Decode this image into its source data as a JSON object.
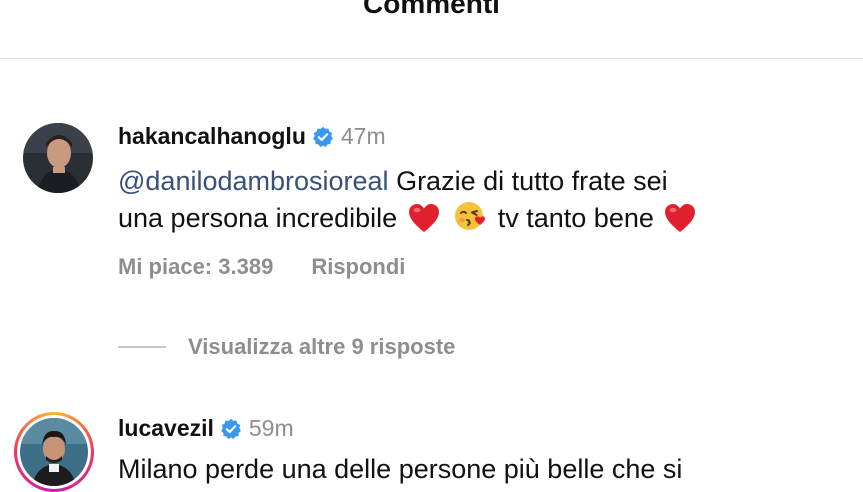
{
  "header": {
    "title": "Commenti"
  },
  "comments": [
    {
      "username": "hakancalhanoglu",
      "verified": true,
      "time": "47m",
      "mention": "@danilodambrosioreal",
      "text_part1": " Grazie di tutto frate sei",
      "text_part2": "una persona incredibile",
      "text_part3": " tv tanto bene",
      "emojis": [
        "red-heart-emoji",
        "face-blowing-kiss-emoji",
        "red-heart-emoji"
      ],
      "likes_label": "Mi piace: 3.389",
      "reply_label": "Rispondi",
      "view_replies_label": "Visualizza altre 9 risposte"
    },
    {
      "username": "lucavezil",
      "verified": true,
      "time": "59m",
      "text_part1": "Milano perde una delle persone più belle che si",
      "has_story_ring": true
    }
  ],
  "colors": {
    "mention": "#38507a",
    "muted": "#8e8e8e",
    "verified": "#3897f0",
    "heart": "#e0202e"
  }
}
